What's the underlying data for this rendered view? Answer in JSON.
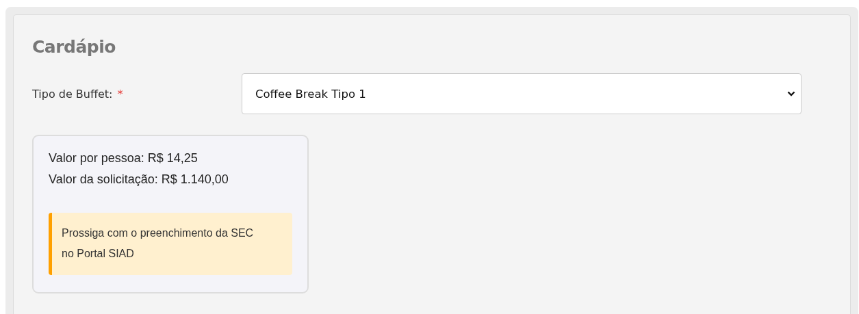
{
  "section": {
    "title": "Cardápio"
  },
  "field": {
    "label": "Tipo de Buffet:",
    "required": true,
    "required_mark": "*",
    "value": "Coffee Break Tipo 1"
  },
  "summary": {
    "lines": [
      "Valor por pessoa: R$ 14,25",
      "Valor da solicitação: R$ 1.140,00"
    ],
    "alert": {
      "kind": "warning",
      "text": "Prossiga com o preenchimento da SEC no Portal SIAD"
    }
  }
}
